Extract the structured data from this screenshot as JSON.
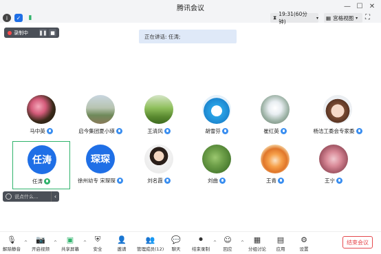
{
  "window": {
    "title": "腾讯会议"
  },
  "toolbar": {
    "time": "19:31(60分钟)",
    "view": "宫格视图"
  },
  "recording": {
    "label": "录制中"
  },
  "speaking": {
    "text": "正在讲话: 任涛;"
  },
  "participants": [
    {
      "name": "马中英",
      "mic": "blue",
      "avatar": "photo-flower"
    },
    {
      "name": "启今集团夏小瑛",
      "mic": "blue",
      "avatar": "photo-landscape"
    },
    {
      "name": "王清风",
      "mic": "blue",
      "avatar": "photo-field"
    },
    {
      "name": "胡雪芬",
      "mic": "blue",
      "avatar": "photo-doraemon"
    },
    {
      "name": "崔红英",
      "mic": "blue",
      "avatar": "photo-dandelion"
    },
    {
      "name": "杨洁工委会专家委",
      "mic": "blue",
      "avatar": "photo-cartoon-girl"
    },
    {
      "name": "任涛",
      "mic": "green",
      "avatar_text": "任涛"
    },
    {
      "name": "徐州幼专 宋琛琛",
      "mic": "blue",
      "avatar_text": "琛琛"
    },
    {
      "name": "刘名霞",
      "mic": "blue",
      "avatar": "photo-woman"
    },
    {
      "name": "刘曲",
      "mic": "blue",
      "avatar": "photo-lotus"
    },
    {
      "name": "王青",
      "mic": "blue",
      "avatar": "photo-tiger"
    },
    {
      "name": "王宁",
      "mic": "blue",
      "avatar": "photo-blossom"
    }
  ],
  "chat": {
    "placeholder": "说点什么..."
  },
  "bottom": {
    "unmute": "解除静音",
    "video": "开启视频",
    "share": "共享屏幕",
    "security": "安全",
    "invite": "邀请",
    "members": "管理成员(12)",
    "chat": "聊天",
    "end_record": "结束录制",
    "reaction": "回应",
    "breakout": "分组讨论",
    "apps": "应用",
    "settings": "设置",
    "end_meeting": "结束会议"
  },
  "colors": {
    "accent": "#1f6fe6",
    "mic_blue": "#3a8ef0",
    "mic_green": "#2fb36b",
    "end": "#e5484d"
  }
}
